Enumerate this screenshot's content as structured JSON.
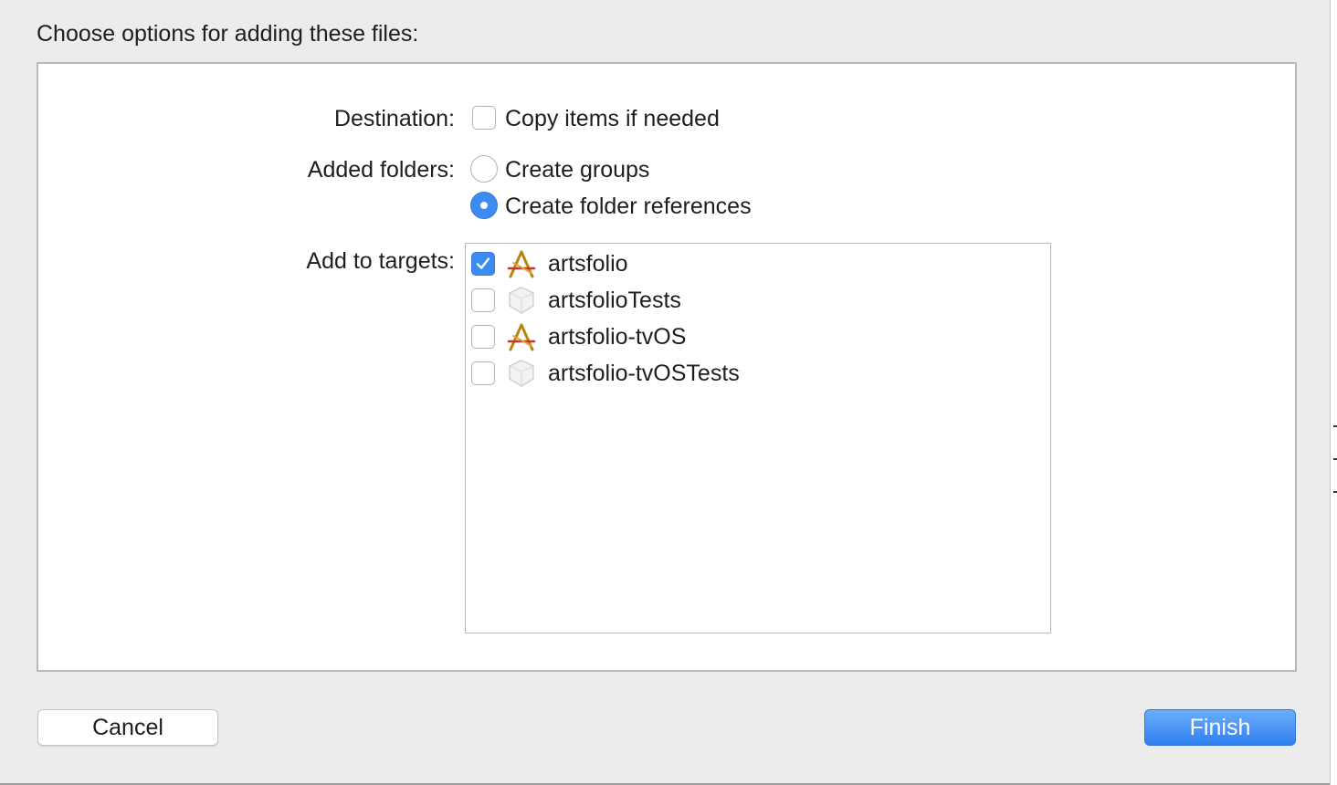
{
  "dialog": {
    "heading": "Choose options for adding these files:"
  },
  "destination": {
    "label": "Destination:",
    "copy_items": {
      "label": "Copy items if needed",
      "checked": false
    }
  },
  "added_folders": {
    "label": "Added folders:",
    "options": [
      {
        "label": "Create groups",
        "selected": false
      },
      {
        "label": "Create folder references",
        "selected": true
      }
    ]
  },
  "targets": {
    "label": "Add to targets:",
    "items": [
      {
        "name": "artsfolio",
        "checked": true,
        "icon": "app-target-icon"
      },
      {
        "name": "artsfolioTests",
        "checked": false,
        "icon": "test-bundle-icon"
      },
      {
        "name": "artsfolio-tvOS",
        "checked": false,
        "icon": "app-target-icon"
      },
      {
        "name": "artsfolio-tvOSTests",
        "checked": false,
        "icon": "test-bundle-icon"
      }
    ]
  },
  "buttons": {
    "cancel": "Cancel",
    "finish": "Finish"
  },
  "colors": {
    "accent": "#3b8bf3",
    "background": "#ececec",
    "panel": "#ffffff"
  }
}
